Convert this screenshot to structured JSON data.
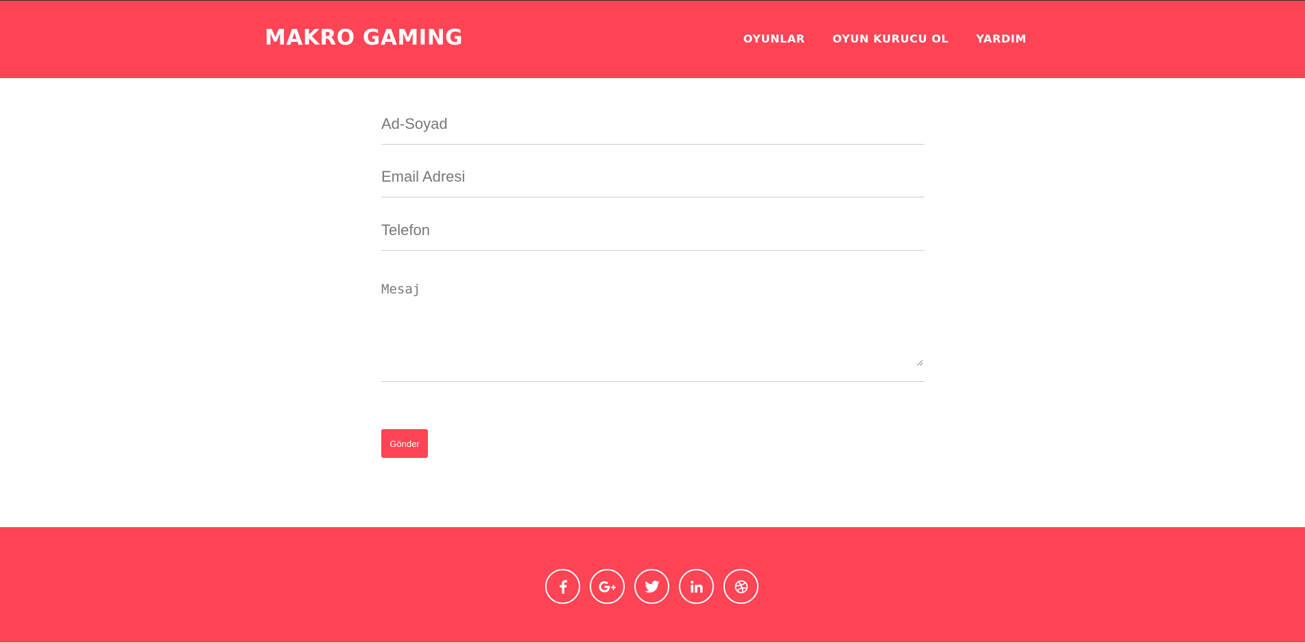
{
  "header": {
    "brand": "MAKRO GAMING",
    "nav": [
      "OYUNLAR",
      "OYUN KURUCU OL",
      "YARDIM"
    ]
  },
  "form": {
    "name_placeholder": "Ad-Soyad",
    "email_placeholder": "Email Adresi",
    "phone_placeholder": "Telefon",
    "message_placeholder": "Mesaj",
    "submit_label": "Gönder"
  },
  "footer": {
    "socials": [
      "facebook-icon",
      "google-plus-icon",
      "twitter-icon",
      "linkedin-icon",
      "dribbble-icon"
    ]
  },
  "colors": {
    "brand": "#ff4455",
    "text_on_brand": "#ffffff"
  }
}
